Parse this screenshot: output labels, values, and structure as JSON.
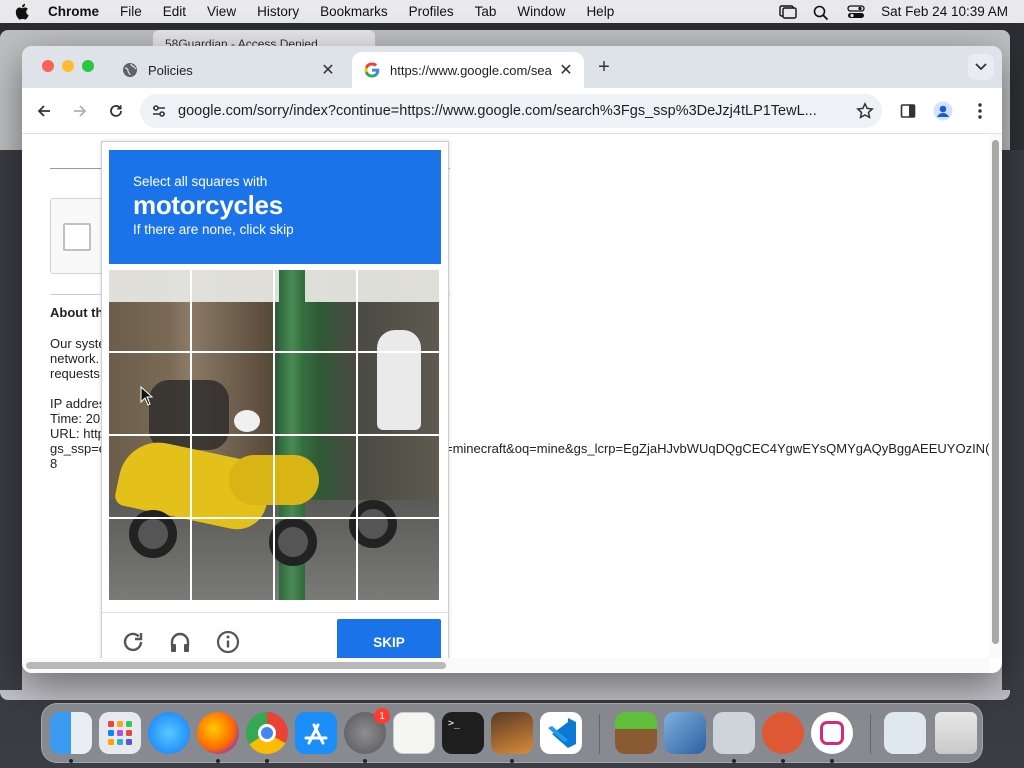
{
  "menubar": {
    "app": "Chrome",
    "items": [
      "File",
      "Edit",
      "View",
      "History",
      "Bookmarks",
      "Profiles",
      "Tab",
      "Window",
      "Help"
    ],
    "clock": "Sat Feb 24  10:39 AM"
  },
  "background_window": {
    "tab_title": "58Guardian - Access Denied"
  },
  "chrome": {
    "tabs": [
      {
        "title": "Policies",
        "icon": "globe-icon",
        "active": false
      },
      {
        "title": "https://www.google.com/sea",
        "icon": "google-icon",
        "active": true
      }
    ],
    "address": "google.com/sorry/index?continue=https://www.google.com/search%3Fgs_ssp%3DeJzj4tLP1TewL..."
  },
  "page": {
    "about_title": "About th",
    "text_lines_1": [
      "Our syste",
      "network.",
      "requests"
    ],
    "text_lines_2": [
      "IP addres",
      "Time: 20",
      "URL: http",
      "gs_ssp=e",
      "8"
    ],
    "url_tail": "=minecraft&oq=mine&gs_lcrp=EgZjaHJvbWUqDQgCEC4YgwEYsQMYgAQyBggAEEUYOzIN("
  },
  "captcha": {
    "line1": "Select all squares with",
    "target": "motorcycles",
    "line3": "If there are none, click skip",
    "grid_size": 4,
    "skip_label": "SKIP",
    "footer_icons": [
      "reload-icon",
      "headphones-icon",
      "info-icon"
    ],
    "accent": "#1a73e8"
  },
  "dock": {
    "apps": [
      "Finder",
      "Launchpad",
      "Safari",
      "Firefox",
      "Chrome",
      "App Store",
      "System Settings",
      "TextEdit",
      "Terminal",
      "GarageBand",
      "Visual Studio Code",
      "Minecraft",
      "VirtualBox",
      "Preview",
      "DuckDuckGo",
      "Instagram",
      "Downloads",
      "Trash"
    ],
    "settings_badge": "1"
  }
}
